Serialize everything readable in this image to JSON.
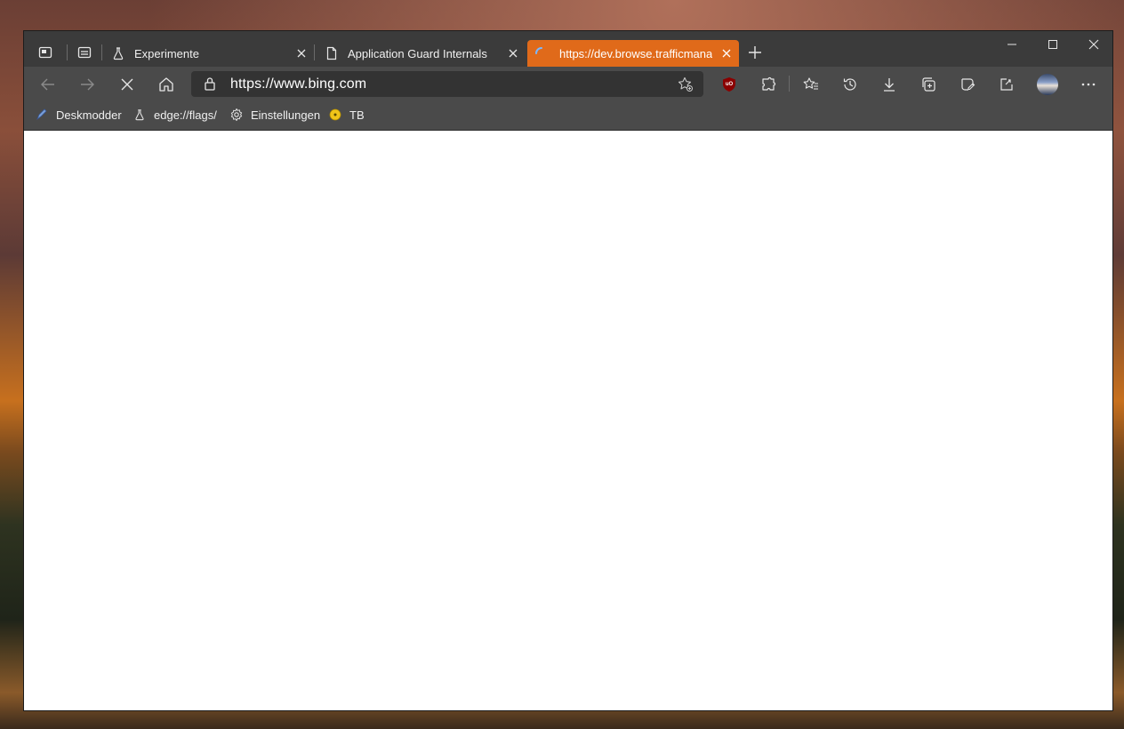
{
  "tabs": [
    {
      "title": "Experimente",
      "icon": "flask-icon"
    },
    {
      "title": "Application Guard Internals",
      "icon": "page-icon"
    },
    {
      "title": "https://dev.browse.trafficmanage",
      "icon": "loading-spinner-icon",
      "active": true
    }
  ],
  "tab_actions": {
    "workspaces_icon": "workspaces-icon",
    "vertical_tabs_icon": "tab-actions-icon",
    "new_tab_icon": "plus-icon"
  },
  "window_controls": {
    "minimize": "minimize-icon",
    "maximize": "maximize-icon",
    "close": "close-icon"
  },
  "toolbar": {
    "url": "https://www.bing.com",
    "icons": [
      "back-arrow-icon",
      "forward-arrow-icon",
      "stop-icon",
      "home-icon",
      "lock-icon",
      "add-favorite-icon",
      "ublock-extension-icon",
      "extensions-icon",
      "favorites-icon",
      "history-icon",
      "download-icon",
      "collections-icon",
      "web-capture-icon",
      "share-icon",
      "profile-avatar",
      "more-icon"
    ],
    "ublock_badge": "uO"
  },
  "favorites": [
    {
      "label": "Deskmodder",
      "icon": "pen-icon"
    },
    {
      "label": "edge://flags/",
      "icon": "flask-icon"
    },
    {
      "label": "Einstellungen",
      "icon": "gear-icon"
    },
    {
      "label": "TB",
      "icon": "yellow-circle-icon"
    }
  ],
  "colors": {
    "active_tab": "#e06a1a",
    "tabstrip": "#3b3b3b",
    "toolbar": "#4a4a4a",
    "address_bar": "#333333",
    "content": "#ffffff"
  }
}
